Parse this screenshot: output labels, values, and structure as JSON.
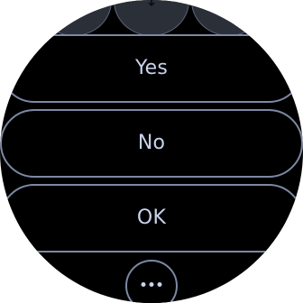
{
  "options": {
    "yes_label": "Yes",
    "no_label": "No",
    "ok_label": "OK"
  },
  "top_icons": [
    "left-action-icon",
    "middle-action-icon",
    "right-action-icon"
  ],
  "bottom_action_icon": "more-options-icon",
  "colors": {
    "background": "#000000",
    "outline": "#7d88a3",
    "text": "#c8d2ea",
    "top_button": "#2b2f38"
  }
}
